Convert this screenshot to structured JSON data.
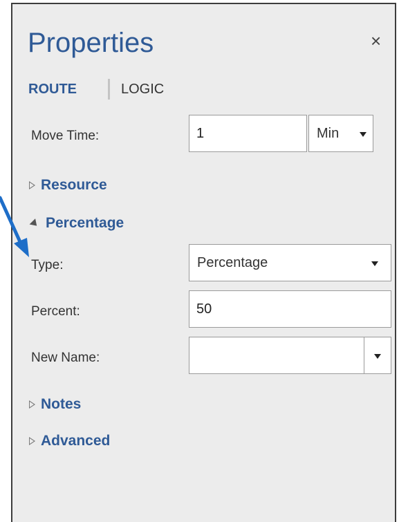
{
  "panel": {
    "title": "Properties",
    "close_glyph": "×"
  },
  "tabs": {
    "route": "ROUTE",
    "logic": "LOGIC"
  },
  "move_time": {
    "label": "Move Time:",
    "value": "1",
    "unit": "Min"
  },
  "sections": {
    "resource": "Resource",
    "percentage": "Percentage",
    "notes": "Notes",
    "advanced": "Advanced"
  },
  "percentage": {
    "type_label": "Type:",
    "type_value": "Percentage",
    "percent_label": "Percent:",
    "percent_value": "50",
    "new_name_label": "New Name:",
    "new_name_value": ""
  },
  "colors": {
    "accent": "#2f5a96",
    "panel_bg": "#ececec",
    "arrow": "#1e6ec8"
  },
  "icons": {
    "close": "close-icon",
    "collapsed": "triangle-right-icon",
    "expanded": "triangle-down-icon",
    "dropdown": "chevron-down-icon",
    "annotation": "arrow-icon"
  }
}
